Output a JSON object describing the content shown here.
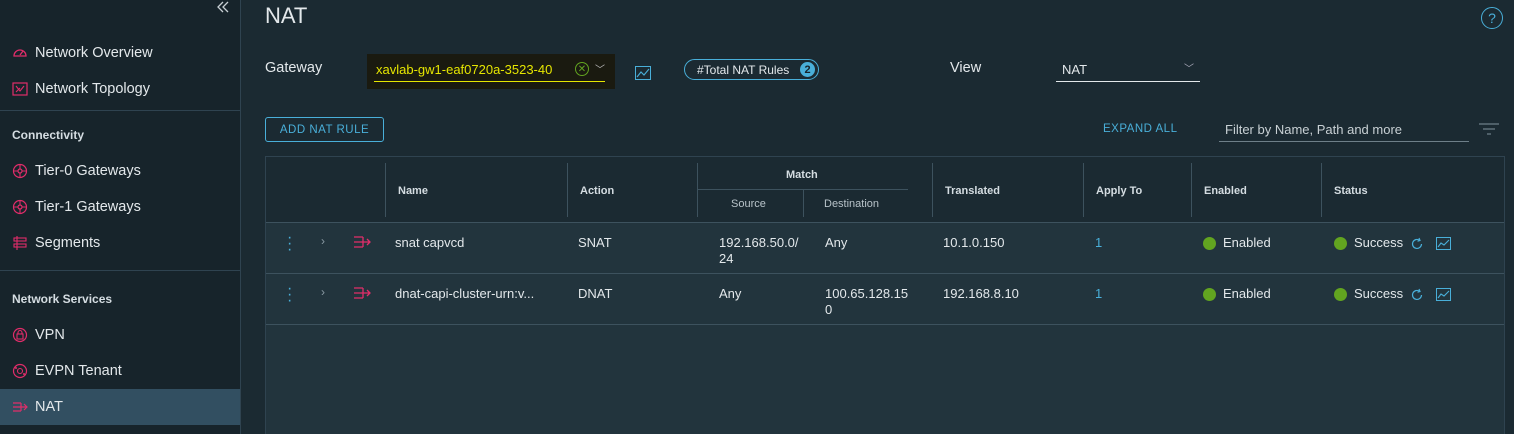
{
  "sidebar": {
    "items_top": [
      {
        "label": "Network Overview",
        "icon": "gauge-icon"
      },
      {
        "label": "Network Topology",
        "icon": "topology-icon"
      }
    ],
    "connectivity_title": "Connectivity",
    "connectivity": [
      {
        "label": "Tier-0 Gateways",
        "icon": "gateway-icon"
      },
      {
        "label": "Tier-1 Gateways",
        "icon": "gateway-icon"
      },
      {
        "label": "Segments",
        "icon": "segments-icon"
      }
    ],
    "services_title": "Network Services",
    "services": [
      {
        "label": "VPN",
        "icon": "lock-icon"
      },
      {
        "label": "EVPN Tenant",
        "icon": "globe-icon"
      },
      {
        "label": "NAT",
        "icon": "nat-icon",
        "active": true
      }
    ]
  },
  "page": {
    "title": "NAT",
    "help": "?"
  },
  "toolbar": {
    "gateway_label": "Gateway",
    "gateway_value": "xavlab-gw1-eaf0720a-3523-40",
    "total_rules_label": "#Total NAT Rules",
    "total_rules_count": "2",
    "view_label": "View",
    "view_value": "NAT",
    "add_button": "ADD NAT RULE",
    "expand_all": "EXPAND ALL",
    "filter_placeholder": "Filter by Name, Path and more"
  },
  "table": {
    "headers": {
      "name": "Name",
      "action": "Action",
      "match": "Match",
      "source": "Source",
      "destination": "Destination",
      "translated": "Translated",
      "apply_to": "Apply To",
      "enabled": "Enabled",
      "status": "Status"
    },
    "rows": [
      {
        "name": "snat capvcd",
        "action": "SNAT",
        "source_l1": "192.168.50.0/",
        "source_l2": "24",
        "dest_l1": "Any",
        "dest_l2": "",
        "translated": "10.1.0.150",
        "apply_to": "1",
        "enabled": "Enabled",
        "status": "Success"
      },
      {
        "name": "dnat-capi-cluster-urn:v...",
        "action": "DNAT",
        "source_l1": "Any",
        "source_l2": "",
        "dest_l1": "100.65.128.15",
        "dest_l2": "0",
        "translated": "192.168.8.10",
        "apply_to": "1",
        "enabled": "Enabled",
        "status": "Success"
      }
    ]
  },
  "colors": {
    "accent": "#49afd9",
    "success": "#62a420",
    "highlight": "#e6e600",
    "nat_icon": "#e12d6a"
  }
}
